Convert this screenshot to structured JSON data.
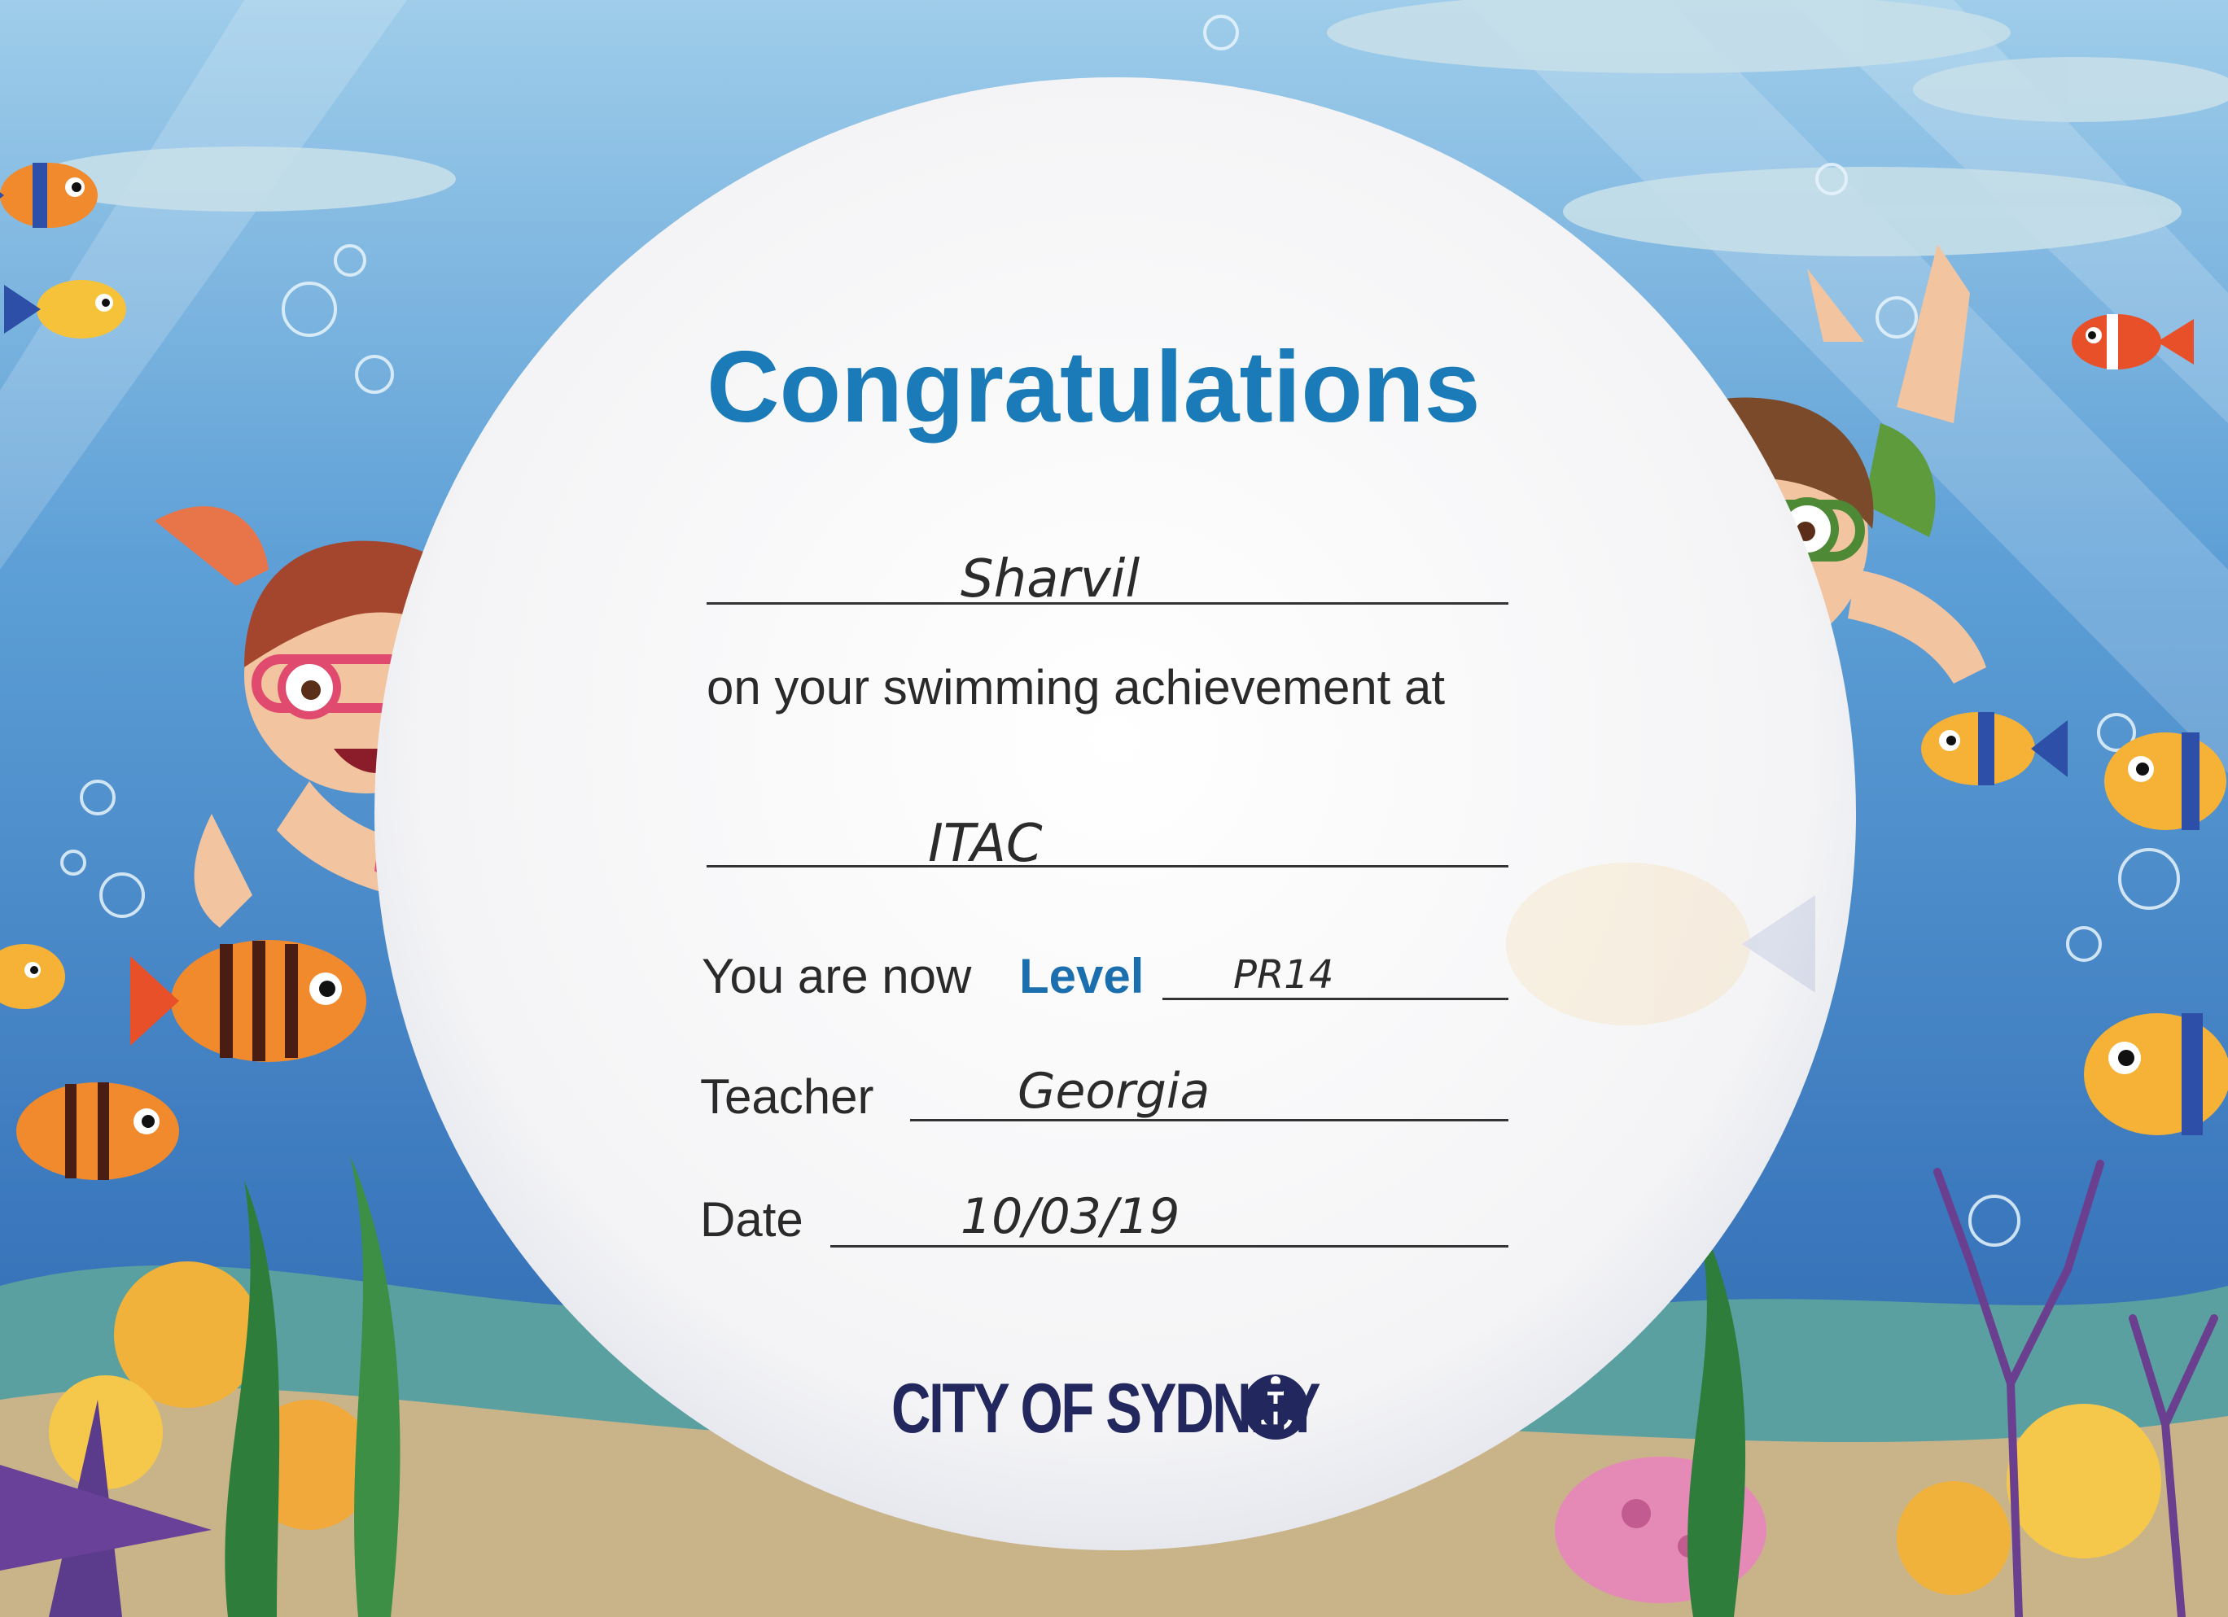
{
  "certificate": {
    "title": "Congratulations",
    "name_value": "Sharvil",
    "achievement_text": "on your swimming achievement at",
    "venue_value": "ITAC",
    "level_prefix": "You are now",
    "level_label": "Level",
    "level_value": "PR14",
    "teacher_label": "Teacher",
    "teacher_value": "Georgia",
    "date_label": "Date",
    "date_value": "10/03/19",
    "issuer": "CITY OF SYDNEY"
  },
  "colors": {
    "title_blue": "#1b7bb8",
    "level_blue": "#1b6fae",
    "issuer_navy": "#22285e",
    "ocean_light": "#8cc4e6",
    "ocean_dark": "#2f6fb4"
  }
}
